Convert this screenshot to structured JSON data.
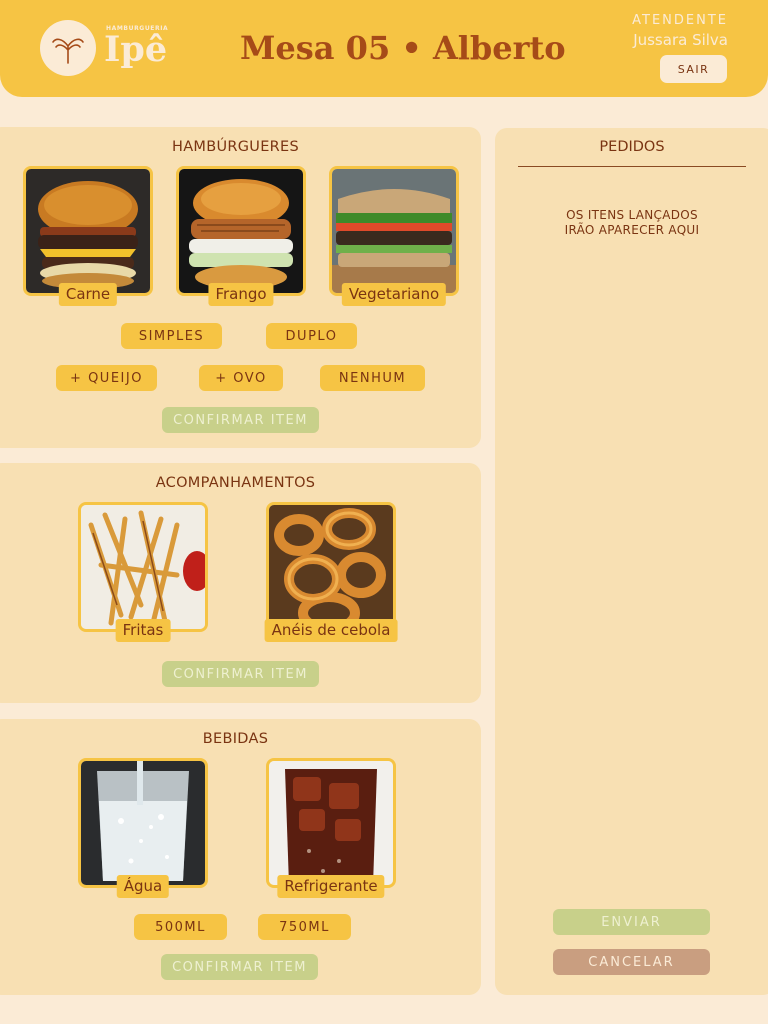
{
  "header": {
    "logo_small": "HAMBURGUERIA",
    "logo_big": "Ipê",
    "table_title": "Mesa 05 • Alberto",
    "attendant_label": "ATENDENTE",
    "attendant_name": "Jussara Silva",
    "logout_label": "SAIR"
  },
  "burgers": {
    "title": "HAMBÚRGUERES",
    "items": [
      {
        "label": "Carne",
        "icon": "beef-burger-image"
      },
      {
        "label": "Frango",
        "icon": "chicken-burger-image"
      },
      {
        "label": "Vegetariano",
        "icon": "veggie-sandwich-image"
      }
    ],
    "sizes": [
      "SIMPLES",
      "DUPLO"
    ],
    "extras": [
      "+ QUEIJO",
      "+ OVO",
      "NENHUM"
    ],
    "confirm_label": "CONFIRMAR ITEM"
  },
  "sides": {
    "title": "ACOMPANHAMENTOS",
    "items": [
      {
        "label": "Fritas",
        "icon": "fries-image"
      },
      {
        "label": "Anéis de cebola",
        "icon": "onion-rings-image"
      }
    ],
    "confirm_label": "CONFIRMAR ITEM"
  },
  "drinks": {
    "title": "BEBIDAS",
    "items": [
      {
        "label": "Água",
        "icon": "water-glass-image"
      },
      {
        "label": "Refrigerante",
        "icon": "soda-glass-image"
      }
    ],
    "sizes": [
      "500ML",
      "750ML"
    ],
    "confirm_label": "CONFIRMAR ITEM"
  },
  "orders": {
    "title": "PEDIDOS",
    "empty_line1": "OS ITENS LANÇADOS",
    "empty_line2": "IRÃO APARECER AQUI",
    "send_label": "ENVIAR",
    "cancel_label": "CANCELAR"
  },
  "colors": {
    "background": "#fbebd6",
    "header": "#f6c444",
    "panel": "#f8e0b3",
    "accent": "#f6c444",
    "text": "#7a3412",
    "title": "#a64b18",
    "confirm_disabled": "#c8d08a",
    "cancel": "#c99e80"
  }
}
